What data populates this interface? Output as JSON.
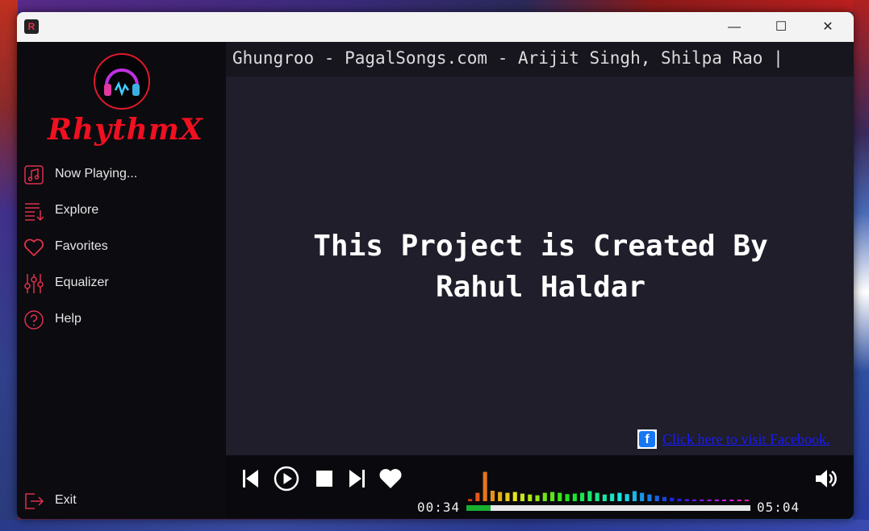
{
  "app": {
    "title_icon_letter": "R",
    "logo_text": "RhythmX",
    "accent_color": "#f01020"
  },
  "window_controls": {
    "minimize_glyph": "—",
    "maximize_glyph": "☐",
    "close_glyph": "✕"
  },
  "sidebar": {
    "items": [
      {
        "label": "Now Playing...",
        "icon": "music-note-icon"
      },
      {
        "label": "Explore",
        "icon": "playlist-icon"
      },
      {
        "label": "Favorites",
        "icon": "heart-icon"
      },
      {
        "label": "Equalizer",
        "icon": "equalizer-icon"
      },
      {
        "label": "Help",
        "icon": "help-icon"
      }
    ],
    "exit_label": "Exit"
  },
  "now_playing": {
    "track_marquee": "Ghungroo - PagalSongs.com - Arijit Singh, Shilpa Rao |"
  },
  "content": {
    "credit_line1": "This Project is Created By",
    "credit_line2": "Rahul Haldar",
    "facebook_link": "Click here to visit Facebook.",
    "facebook_icon_letter": "f"
  },
  "player": {
    "elapsed": "00:34",
    "duration": "05:04",
    "progress_fraction": 0.085,
    "progress_color": "#18b030",
    "visualizer_levels": [
      0.05,
      0.2,
      0.7,
      0.25,
      0.22,
      0.2,
      0.22,
      0.18,
      0.16,
      0.14,
      0.2,
      0.22,
      0.2,
      0.17,
      0.18,
      0.2,
      0.24,
      0.2,
      0.16,
      0.18,
      0.2,
      0.17,
      0.24,
      0.2,
      0.16,
      0.13,
      0.1,
      0.08,
      0.06,
      0.05,
      0.04,
      0.04,
      0.04,
      0.04,
      0.03,
      0.03,
      0.03,
      0.03
    ]
  }
}
